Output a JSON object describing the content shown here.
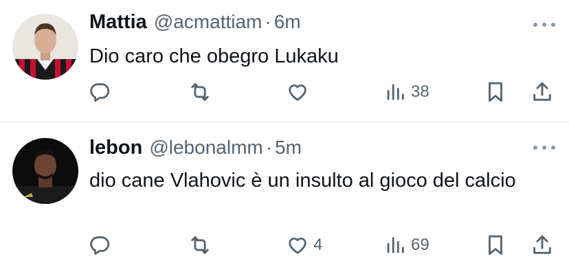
{
  "tweets": [
    {
      "author": {
        "name": "Mattia",
        "handle": "@acmattiam"
      },
      "separator": "·",
      "time": "6m",
      "text": "Dio caro che obegro Lukaku",
      "stats": {
        "replies": "",
        "retweets": "",
        "likes": "",
        "views": "38"
      }
    },
    {
      "author": {
        "name": "lebon",
        "handle": "@lebonalmm"
      },
      "separator": "·",
      "time": "5m",
      "text": "dio cane Vlahovic è un insulto al gioco del calcio",
      "stats": {
        "replies": "",
        "retweets": "",
        "likes": "4",
        "views": "69"
      }
    }
  ],
  "icons": {
    "reply": "reply-icon",
    "retweet": "retweet-icon",
    "like": "heart-icon",
    "views": "views-icon",
    "bookmark": "bookmark-icon",
    "share": "share-icon",
    "more": "more-icon"
  },
  "colors": {
    "text": "#0f1419",
    "secondary": "#536471",
    "divider": "#e6e9ec"
  }
}
